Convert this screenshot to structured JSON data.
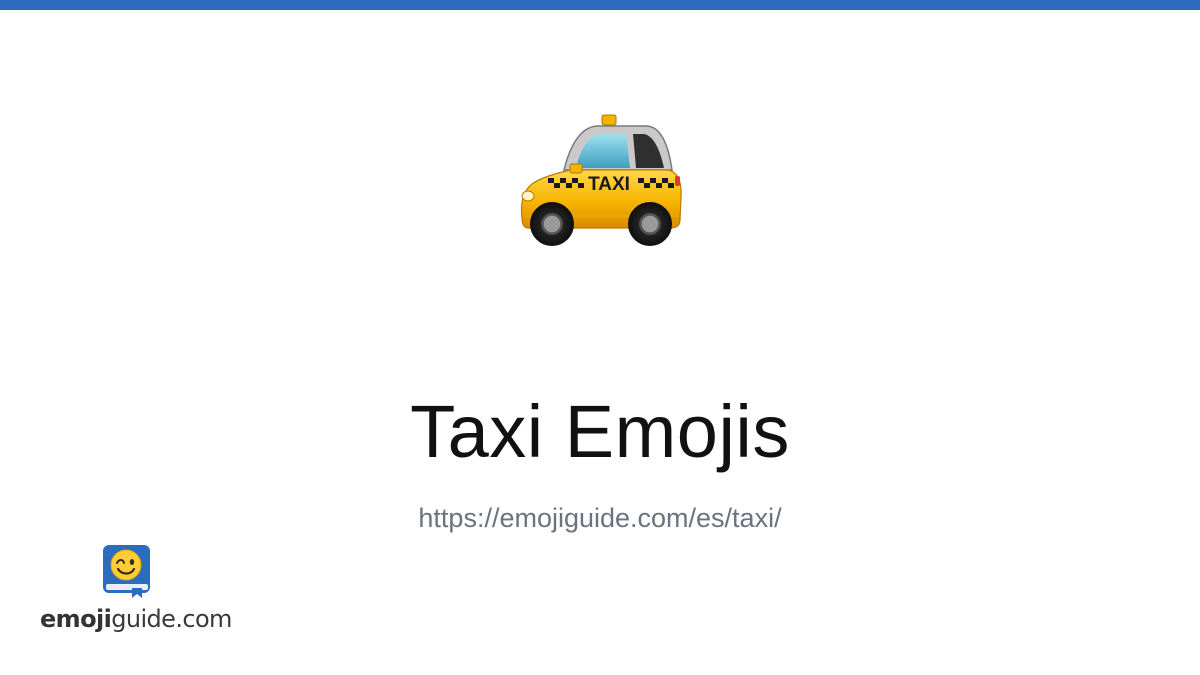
{
  "header": {
    "accent_color": "#2b6cbf"
  },
  "hero": {
    "emoji_icon": "taxi-icon",
    "sign_text": "TAXI"
  },
  "main": {
    "title": "Taxi Emojis",
    "url": "https://emojiguide.com/es/taxi/"
  },
  "brand": {
    "logo_icon": "winking-face-book-icon",
    "name_bold": "emoji",
    "name_rest": "guide.com"
  }
}
